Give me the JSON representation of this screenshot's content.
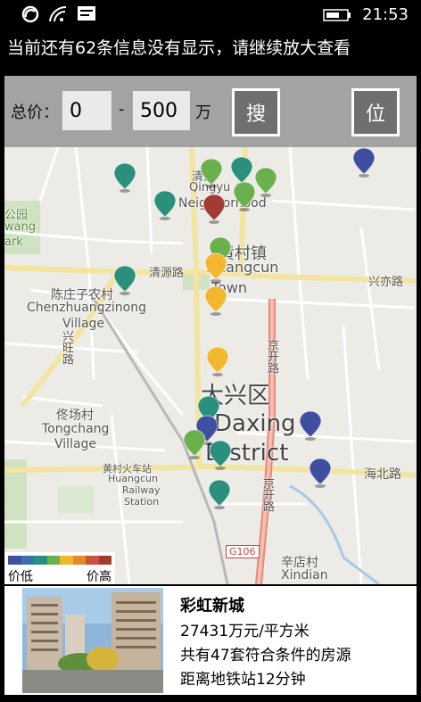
{
  "status_bar": {
    "time": "21:53"
  },
  "notice": "当前还有62条信息没有显示，请继续放大查看",
  "search": {
    "price_label": "总价：",
    "min_value": "0",
    "separator": "-",
    "max_value": "500",
    "unit": "万",
    "search_button": "搜",
    "locate_button": "位"
  },
  "map": {
    "labels": [
      {
        "id": "qingyuan",
        "text": "清源"
      },
      {
        "id": "qingyuan_en",
        "text": "Qingyu"
      },
      {
        "id": "neighborhood_en",
        "text": "Neighborhood"
      },
      {
        "id": "huangcun",
        "text": "黄村镇"
      },
      {
        "id": "huangcun_en1",
        "text": "Huangcun"
      },
      {
        "id": "huangcun_en2",
        "text": "Town"
      },
      {
        "id": "qingyuan_road",
        "text": "清源路"
      },
      {
        "id": "xingyi_road",
        "text": "兴亦路"
      },
      {
        "id": "chenzhuang",
        "text": "陈庄子农村"
      },
      {
        "id": "chenzhuang_en1",
        "text": "Chenzhuangzinong"
      },
      {
        "id": "chenzhuang_en2",
        "text": "Village"
      },
      {
        "id": "xingwang_road",
        "text": "兴旺路"
      },
      {
        "id": "jingkai_road",
        "text": "京开路"
      },
      {
        "id": "daxing",
        "text": "大兴区"
      },
      {
        "id": "daxing_en1",
        "text": "Daxing"
      },
      {
        "id": "daxing_en2",
        "text": "District"
      },
      {
        "id": "tongchang",
        "text": "佟场村"
      },
      {
        "id": "tongchang_en1",
        "text": "Tongchang"
      },
      {
        "id": "tongchang_en2",
        "text": "Village"
      },
      {
        "id": "station",
        "text": "黄村火车站"
      },
      {
        "id": "station_en1",
        "text": "Huangcun"
      },
      {
        "id": "station_en2",
        "text": "Railway"
      },
      {
        "id": "station_en3",
        "text": "Station"
      },
      {
        "id": "haibei_road",
        "text": "海北路"
      },
      {
        "id": "jingkai_road2",
        "text": "京开路"
      },
      {
        "id": "g106",
        "text": "G106"
      },
      {
        "id": "xindian",
        "text": "辛店村"
      },
      {
        "id": "xindian_en",
        "text": "Xindian"
      },
      {
        "id": "park",
        "text": "公园"
      },
      {
        "id": "wang",
        "text": "wang"
      },
      {
        "id": "ark",
        "text": "ark"
      }
    ],
    "pins": [
      {
        "id": "p1",
        "color": "#2a8f7d"
      },
      {
        "id": "p2",
        "color": "#2a8f7d"
      },
      {
        "id": "p3",
        "color": "#6ab04c"
      },
      {
        "id": "p4",
        "color": "#2a8f7d"
      },
      {
        "id": "p5",
        "color": "#6ab04c"
      },
      {
        "id": "p6",
        "color": "#6ab04c"
      },
      {
        "id": "p7",
        "color": "#a23b32"
      },
      {
        "id": "p8",
        "color": "#3f4f9f"
      },
      {
        "id": "p9",
        "color": "#6ab04c"
      },
      {
        "id": "p10",
        "color": "#f3b72f"
      },
      {
        "id": "p11",
        "color": "#2a8f7d"
      },
      {
        "id": "p12",
        "color": "#f3b72f"
      },
      {
        "id": "p13",
        "color": "#f3b72f"
      },
      {
        "id": "p14",
        "color": "#2a8f7d"
      },
      {
        "id": "p15",
        "color": "#3f4f9f"
      },
      {
        "id": "p16",
        "color": "#3f4f9f"
      },
      {
        "id": "p17",
        "color": "#6ab04c"
      },
      {
        "id": "p18",
        "color": "#2a8f7d"
      },
      {
        "id": "p19",
        "color": "#3f4f9f"
      },
      {
        "id": "p20",
        "color": "#2a8f7d"
      }
    ]
  },
  "legend": {
    "low": "价低",
    "high": "价高",
    "colors": [
      "#3f4f9f",
      "#3a6fae",
      "#2a8f7d",
      "#6ab04c",
      "#f3b72f",
      "#e08a2c",
      "#c7533a",
      "#a23b32"
    ]
  },
  "info_card": {
    "name": "彩虹新城",
    "price": "27431万元/平方米",
    "count": "共有47套符合条件的房源",
    "subway": "距离地铁站12分钟"
  }
}
